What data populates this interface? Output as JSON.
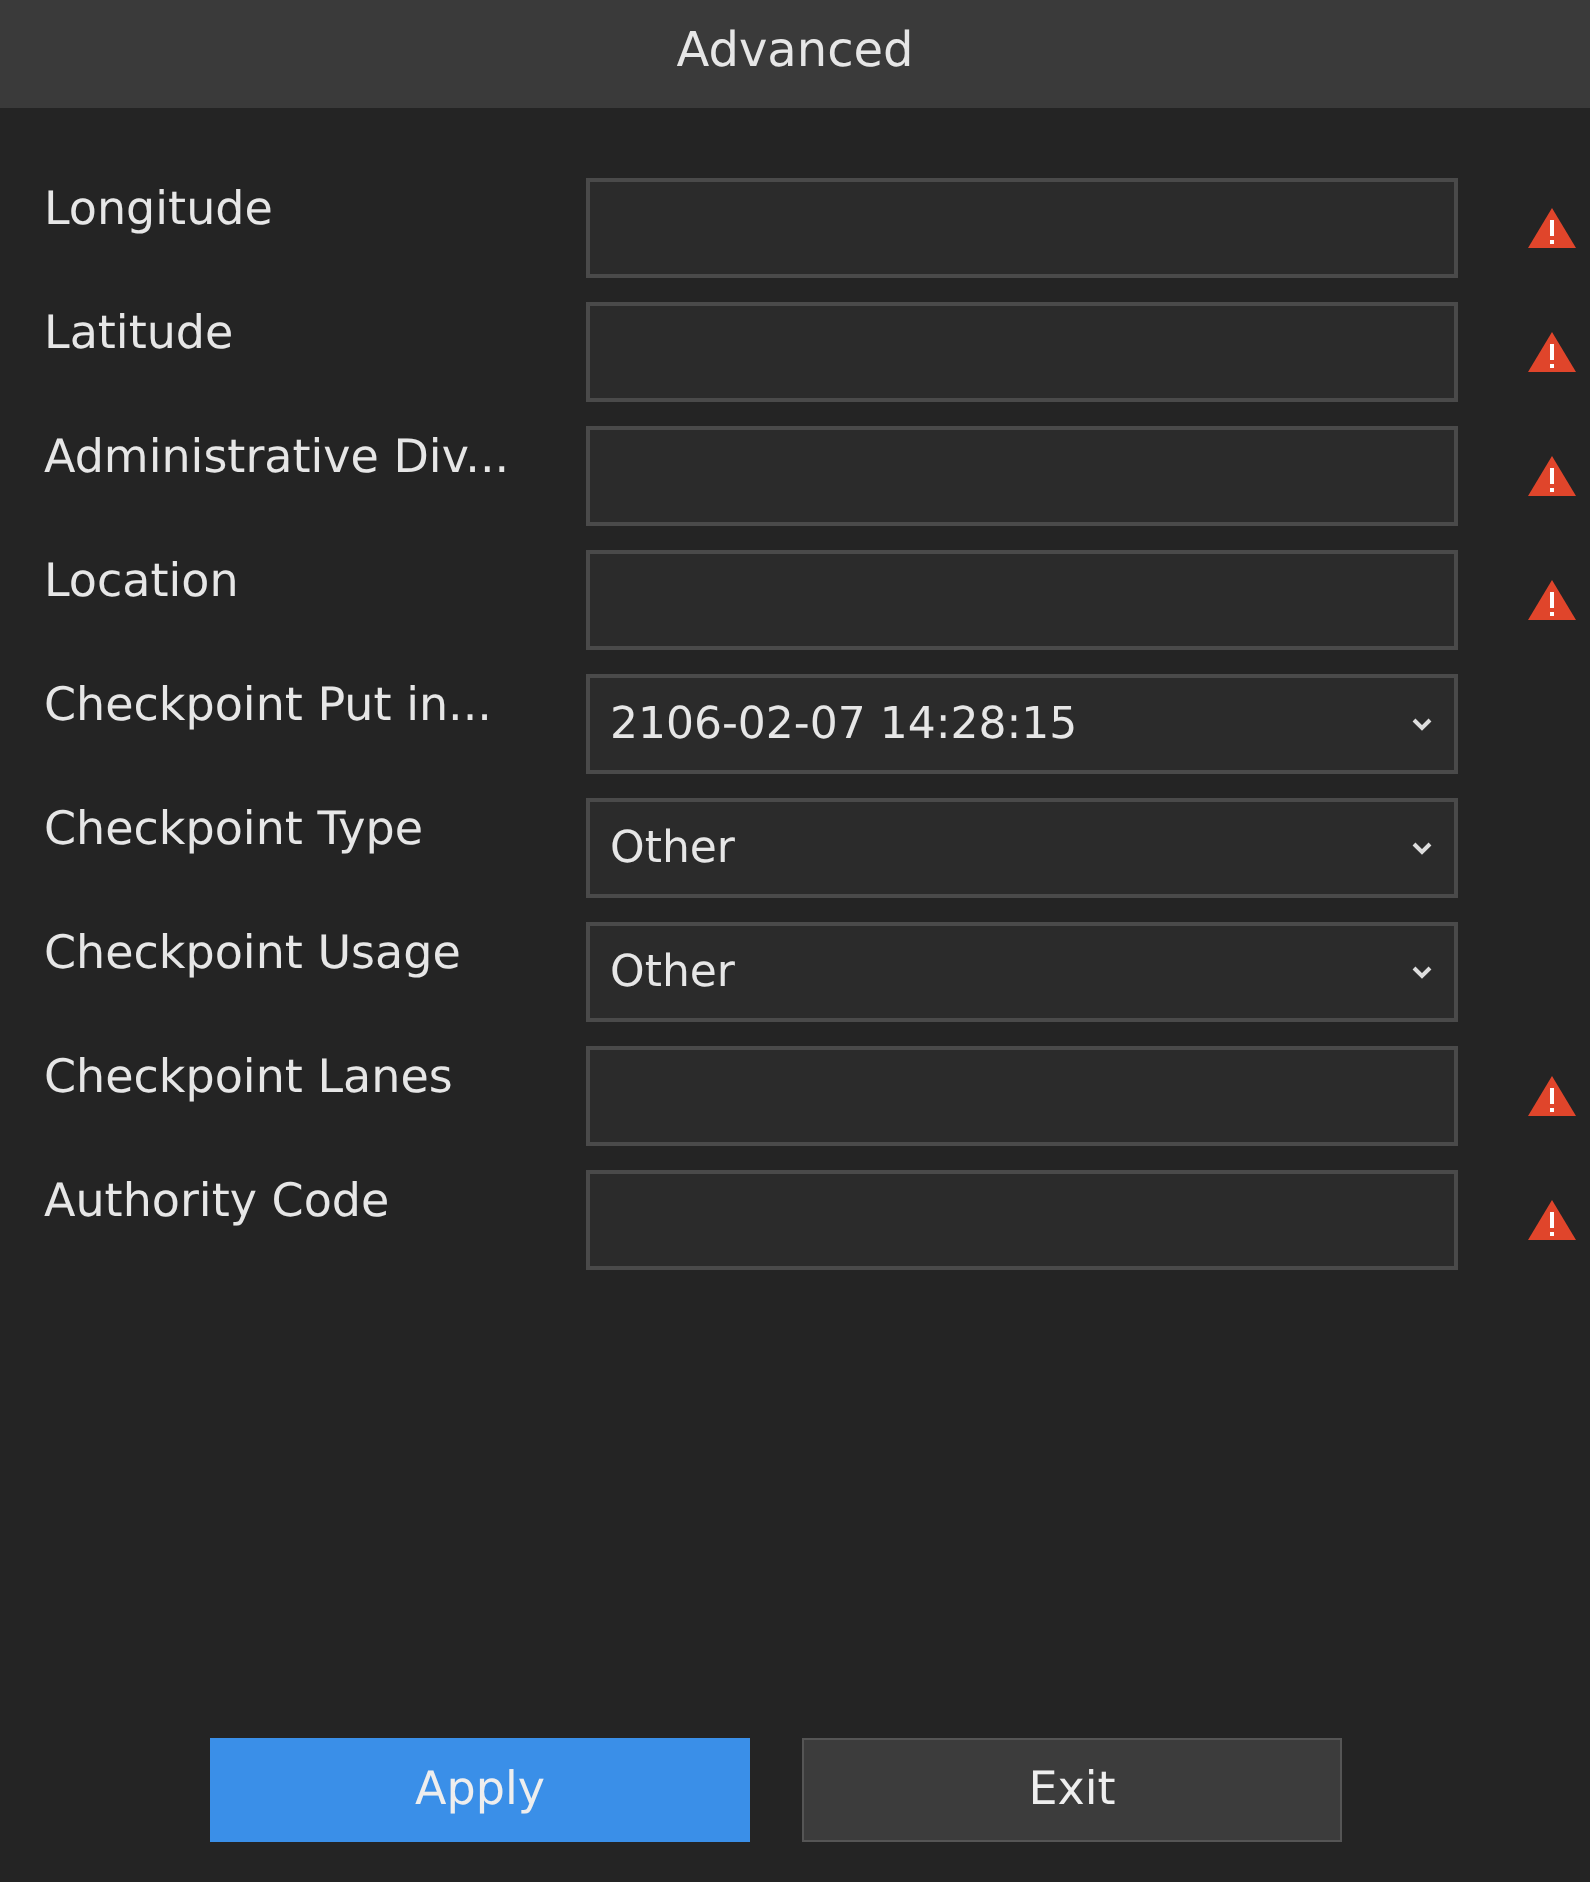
{
  "window": {
    "title": "Advanced"
  },
  "fields": [
    {
      "label": "Longitude",
      "kind": "text",
      "warning": true
    },
    {
      "label": "Latitude",
      "kind": "text",
      "warning": true
    },
    {
      "label": "Administrative Div...",
      "kind": "text",
      "warning": true
    },
    {
      "label": "Location",
      "kind": "text",
      "warning": true
    },
    {
      "label": "Checkpoint Put in...",
      "kind": "select",
      "value": "2106-02-07 14:28:15",
      "warning": false
    },
    {
      "label": "Checkpoint Type",
      "kind": "select",
      "value": "Other",
      "warning": false
    },
    {
      "label": "Checkpoint Usage",
      "kind": "select",
      "value": "Other",
      "warning": false
    },
    {
      "label": "Checkpoint Lanes",
      "kind": "text",
      "warning": true
    },
    {
      "label": "Authority Code",
      "kind": "text",
      "warning": true
    }
  ],
  "buttons": [
    {
      "label": "Apply",
      "kind": "primary"
    },
    {
      "label": "Exit",
      "kind": "secondary"
    }
  ]
}
